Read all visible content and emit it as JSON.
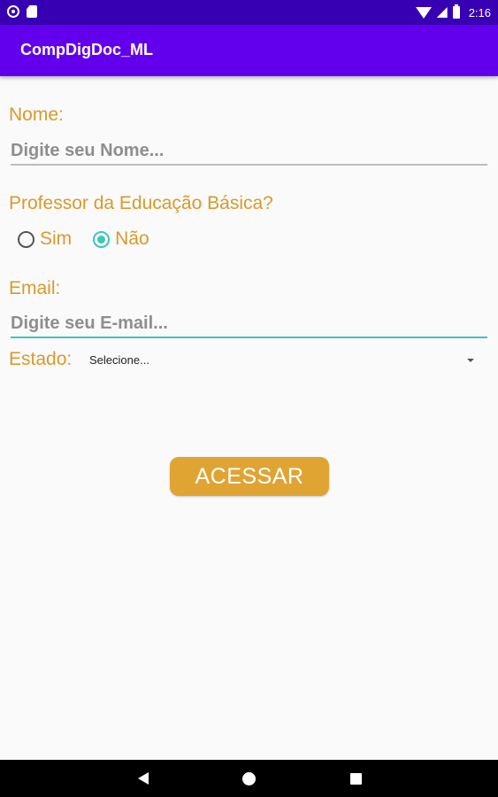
{
  "status_bar": {
    "time": "2:16",
    "left_icons": [
      "notification-icon",
      "sd-card-icon"
    ],
    "right_icons": [
      "wifi-icon",
      "signal-icon",
      "battery-icon"
    ]
  },
  "app_bar": {
    "title": "CompDigDoc_ML",
    "color": "#6200ee",
    "status_color": "#3700b3"
  },
  "form": {
    "nome": {
      "label": "Nome:",
      "placeholder": "Digite seu Nome...",
      "value": ""
    },
    "professor": {
      "label": "Professor da Educação Básica?",
      "options": [
        {
          "label": "Sim",
          "checked": false
        },
        {
          "label": "Não",
          "checked": true
        }
      ]
    },
    "email": {
      "label": "Email:",
      "placeholder": "Digite seu E-mail...",
      "value": ""
    },
    "estado": {
      "label": "Estado:",
      "selected": "Selecione..."
    },
    "submit_label": "ACESSAR"
  },
  "colors": {
    "label": "#d89a2a",
    "accent": "#3ec6b8",
    "button": "#e0a433"
  },
  "nav_bar": {
    "icons": [
      "back-icon",
      "home-icon",
      "recent-apps-icon"
    ]
  }
}
